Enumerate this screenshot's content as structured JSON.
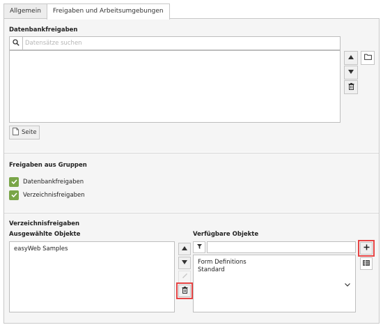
{
  "tabs": [
    {
      "label": "Allgemein",
      "active": false
    },
    {
      "label": "Freigaben und Arbeitsumgebungen",
      "active": true
    }
  ],
  "db_mounts": {
    "title": "Datenbankfreigaben",
    "search_placeholder": "Datensätze suchen",
    "page_button_label": "Seite",
    "items": []
  },
  "group_mounts": {
    "title": "Freigaben aus Gruppen",
    "options": [
      {
        "label": "Datenbankfreigaben",
        "checked": true
      },
      {
        "label": "Verzeichnisfreigaben",
        "checked": true
      }
    ]
  },
  "file_mounts": {
    "title": "Verzeichnisfreigaben",
    "selected_title": "Ausgewählte Objekte",
    "selected_items": [
      "easyWeb Samples"
    ],
    "available_title": "Verfügbare Objekte",
    "filter_value": "",
    "available_items": [
      "Form Definitions",
      "Standard"
    ]
  },
  "colors": {
    "checkbox": "#79a548",
    "highlight": "#e64545",
    "section_bg": "#f5f5f5"
  },
  "icons": {
    "search": "search-icon",
    "up": "arrow-up-icon",
    "down": "arrow-down-icon",
    "delete": "trash-icon",
    "browse": "folder-icon",
    "page": "page-icon",
    "filter": "filter-icon",
    "edit": "pencil-icon",
    "add": "plus-icon",
    "list": "list-icon",
    "check": "check-icon",
    "expand": "chevron-down-icon"
  }
}
